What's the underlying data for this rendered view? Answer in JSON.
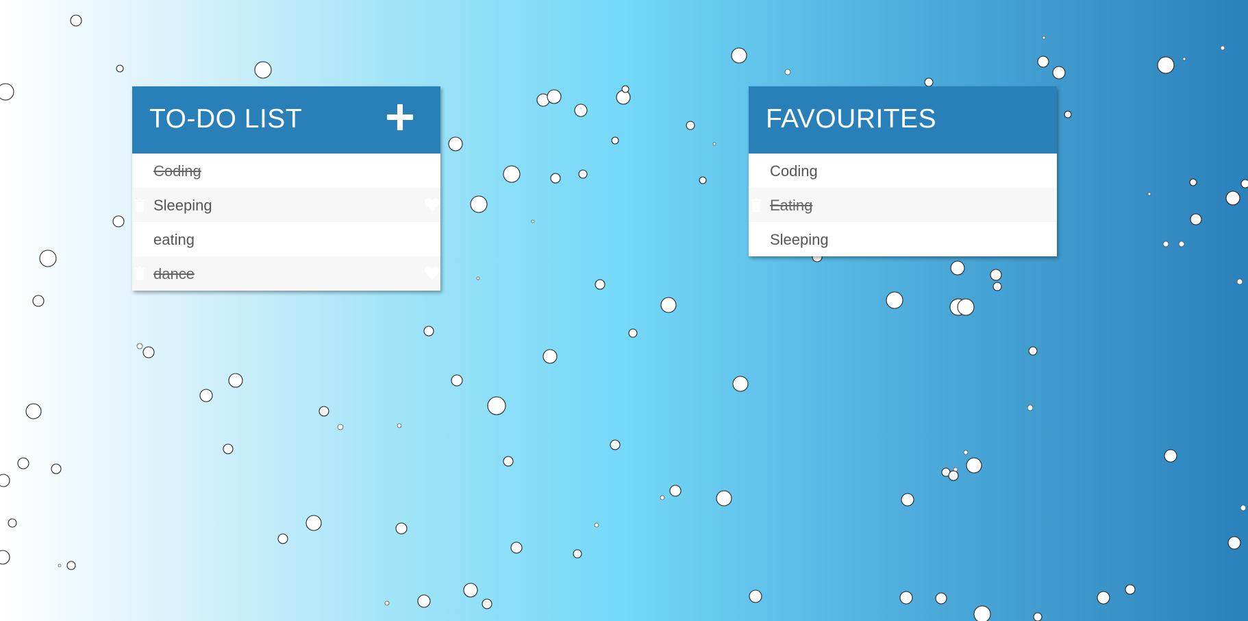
{
  "todo": {
    "title": "TO-DO LIST",
    "add_icon": "plus-icon",
    "items": [
      {
        "label": "Coding",
        "done": true
      },
      {
        "label": "Sleeping",
        "done": false
      },
      {
        "label": "eating",
        "done": false
      },
      {
        "label": "dance",
        "done": true
      }
    ]
  },
  "favourites": {
    "title": "FAVOURITES",
    "items": [
      {
        "label": "Coding",
        "done": false
      },
      {
        "label": "Eating",
        "done": true
      },
      {
        "label": "Sleeping",
        "done": false
      }
    ]
  },
  "icons": {
    "delete": "trash-icon",
    "favourite": "heart-icon"
  },
  "colors": {
    "header": "#2980b9",
    "gradient_start": "#ffffff",
    "gradient_mid": "#74d8f8",
    "gradient_end": "#2b81bb"
  }
}
